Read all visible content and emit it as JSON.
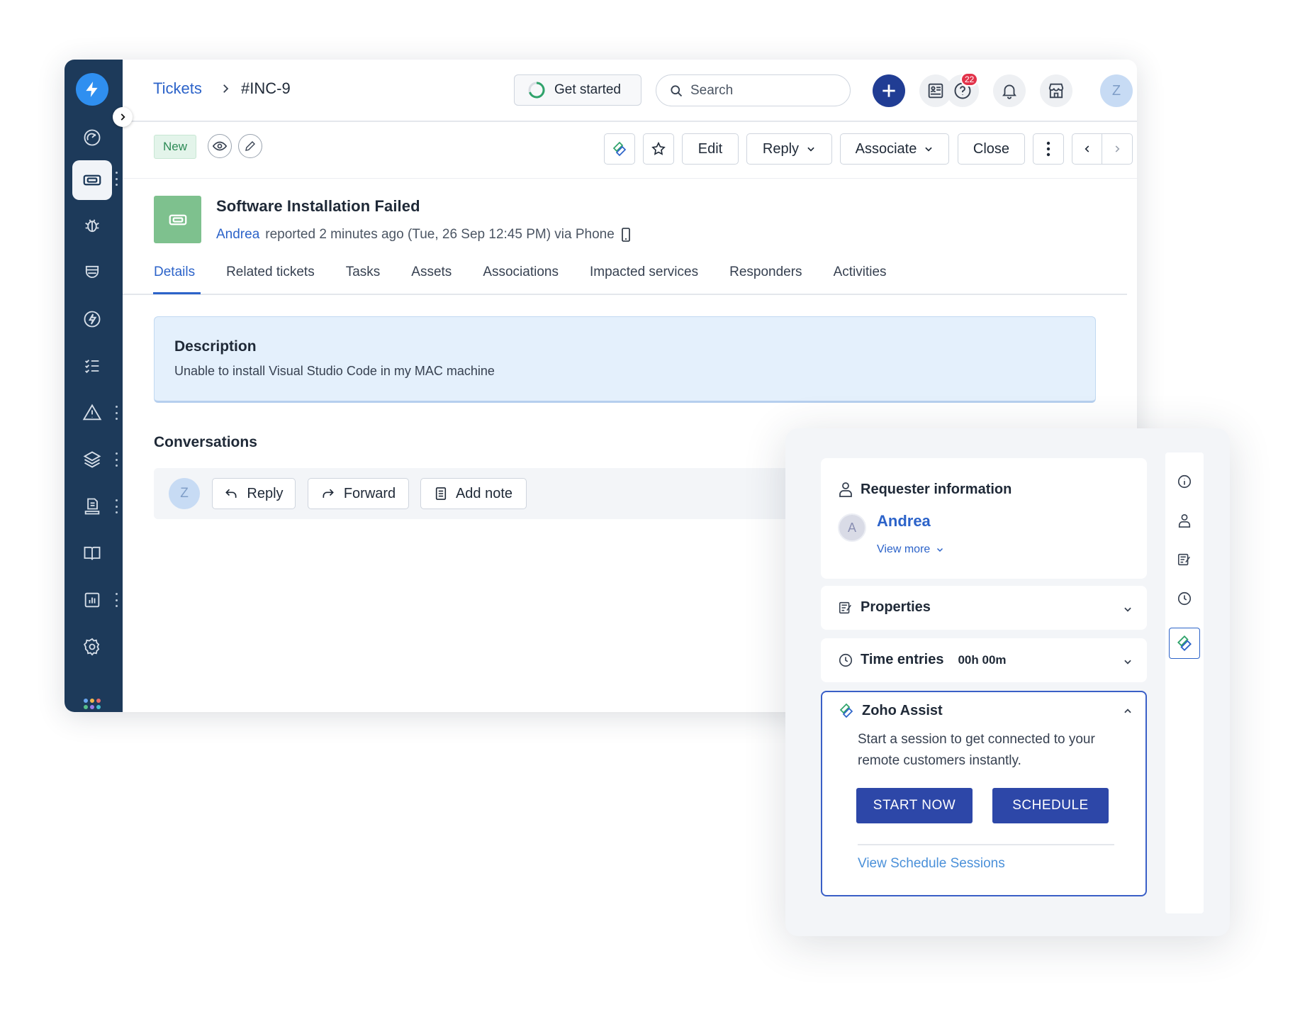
{
  "breadcrumb": {
    "root": "Tickets",
    "current": "#INC-9"
  },
  "header": {
    "get_started": "Get started",
    "search_placeholder": "Search",
    "help_badge": "22",
    "avatar_initial": "Z"
  },
  "actions": {
    "status": "New",
    "edit": "Edit",
    "reply": "Reply",
    "associate": "Associate",
    "close": "Close"
  },
  "ticket": {
    "title": "Software Installation Failed",
    "requester": "Andrea",
    "meta": "reported 2 minutes ago (Tue, 26 Sep 12:45 PM) via Phone"
  },
  "tabs": [
    "Details",
    "Related tickets",
    "Tasks",
    "Assets",
    "Associations",
    "Impacted services",
    "Responders",
    "Activities"
  ],
  "description": {
    "title": "Description",
    "text": "Unable to install Visual Studio Code in my MAC machine"
  },
  "conversations": {
    "title": "Conversations",
    "avatar_initial": "Z",
    "reply": "Reply",
    "forward": "Forward",
    "add_note": "Add note"
  },
  "panel": {
    "requester": {
      "heading": "Requester information",
      "avatar_initial": "A",
      "name": "Andrea",
      "view_more": "View more"
    },
    "properties": "Properties",
    "time_entries": {
      "label": "Time entries",
      "value": "00h 00m"
    },
    "zoho_assist": {
      "title": "Zoho Assist",
      "text": "Start a session to get connected to your remote customers instantly.",
      "start_now": "START NOW",
      "schedule": "SCHEDULE",
      "view_sessions": "View Schedule Sessions"
    }
  },
  "colors": {
    "sidebar": "#1d3a5a",
    "accent": "#2c63c9",
    "primary_button": "#2d47a8",
    "status_new": "#2c8a55",
    "badge": "#e2334a"
  }
}
